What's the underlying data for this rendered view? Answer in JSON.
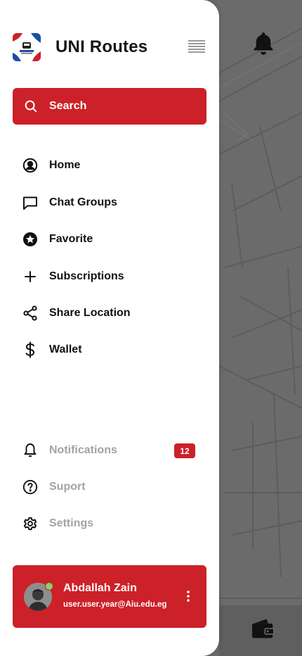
{
  "app": {
    "title": "UNI Routes"
  },
  "search": {
    "label": "Search"
  },
  "nav": {
    "items": [
      {
        "label": "Home",
        "icon": "user-circle-icon"
      },
      {
        "label": "Chat Groups",
        "icon": "chat-icon"
      },
      {
        "label": "Favorite",
        "icon": "star-circle-icon"
      },
      {
        "label": "Subscriptions",
        "icon": "plus-icon"
      },
      {
        "label": "Share Location",
        "icon": "share-icon"
      },
      {
        "label": "Wallet",
        "icon": "dollar-icon"
      }
    ],
    "secondary": [
      {
        "label": "Notifications",
        "icon": "bell-icon",
        "badge": "12"
      },
      {
        "label": "Suport",
        "icon": "help-circle-icon"
      },
      {
        "label": "Settings",
        "icon": "gear-icon"
      }
    ]
  },
  "profile": {
    "name": "Abdallah Zain",
    "email": "user.user.year@Aiu.edu.eg",
    "status": "online"
  },
  "colors": {
    "accent": "#cc2128",
    "drawer_bg": "#ffffff",
    "map_bg": "#6b6b6b",
    "muted_text": "#a3a3a3",
    "online": "#7dd66b"
  }
}
